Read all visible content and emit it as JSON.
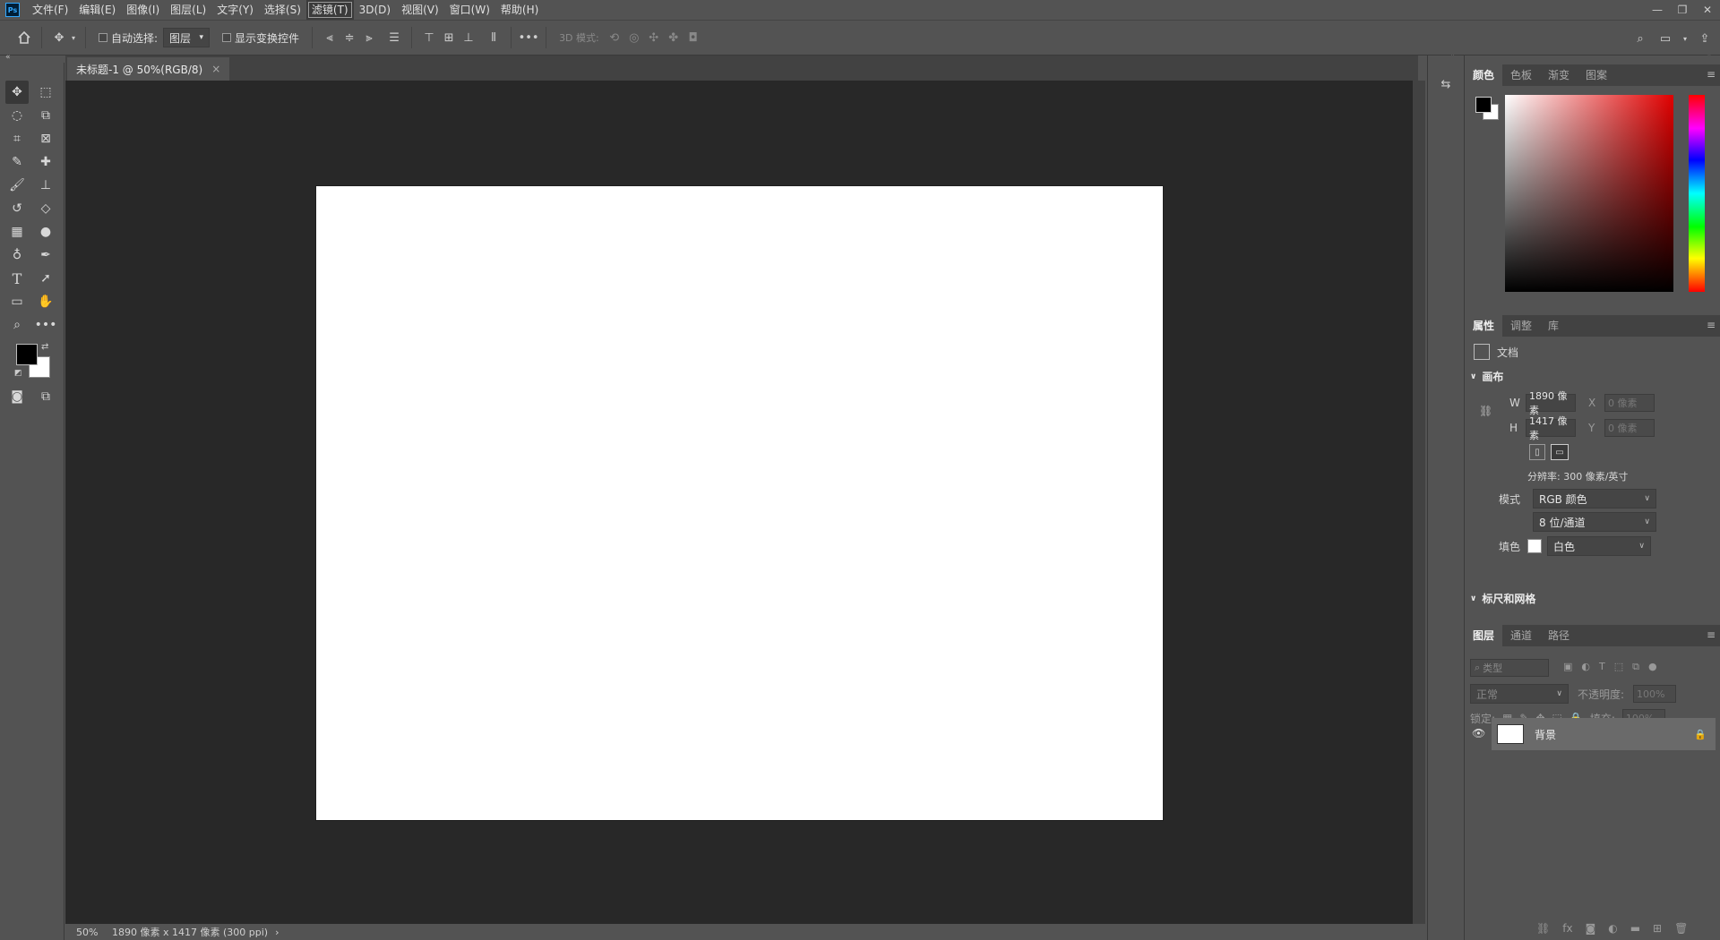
{
  "menubar": {
    "logo": "Ps",
    "items": [
      "文件(F)",
      "编辑(E)",
      "图像(I)",
      "图层(L)",
      "文字(Y)",
      "选择(S)",
      "滤镜(T)",
      "3D(D)",
      "视图(V)",
      "窗口(W)",
      "帮助(H)"
    ],
    "active_index": 6
  },
  "options": {
    "auto_select_label": "自动选择:",
    "auto_select_value": "图层",
    "show_transform_label": "显示变换控件",
    "mode_3d_label": "3D 模式:"
  },
  "document": {
    "tab_title": "未标题-1 @ 50%(RGB/8)",
    "close_glyph": "×"
  },
  "status": {
    "zoom": "50%",
    "info": "1890 像素 x 1417 像素 (300 ppi)",
    "arrow": "›"
  },
  "color_panel": {
    "tabs": [
      "颜色",
      "色板",
      "渐变",
      "图案"
    ],
    "active": 0
  },
  "properties_panel": {
    "tabs": [
      "属性",
      "调整",
      "库"
    ],
    "active": 0,
    "doc_label": "文档",
    "canvas_section": "画布",
    "w_label": "W",
    "w_value": "1890 像素",
    "h_label": "H",
    "h_value": "1417 像素",
    "x_label": "X",
    "x_placeholder": "0 像素",
    "y_label": "Y",
    "y_placeholder": "0 像素",
    "resolution": "分辨率: 300 像素/英寸",
    "mode_label": "模式",
    "mode_value": "RGB 颜色",
    "depth_value": "8 位/通道",
    "fill_label": "填色",
    "fill_value": "白色",
    "rulers_section": "标尺和网格"
  },
  "layers_panel": {
    "tabs": [
      "图层",
      "通道",
      "路径"
    ],
    "active": 0,
    "filter_placeholder": "类型",
    "blend_mode": "正常",
    "opacity_label": "不透明度:",
    "opacity_value": "100%",
    "lock_label": "锁定:",
    "fill_label": "填充:",
    "fill_value": "100%",
    "layer_name": "背景"
  },
  "colors": {
    "foreground": "#000000",
    "background": "#ffffff",
    "ui_bg": "#535353",
    "workspace": "#282828"
  }
}
